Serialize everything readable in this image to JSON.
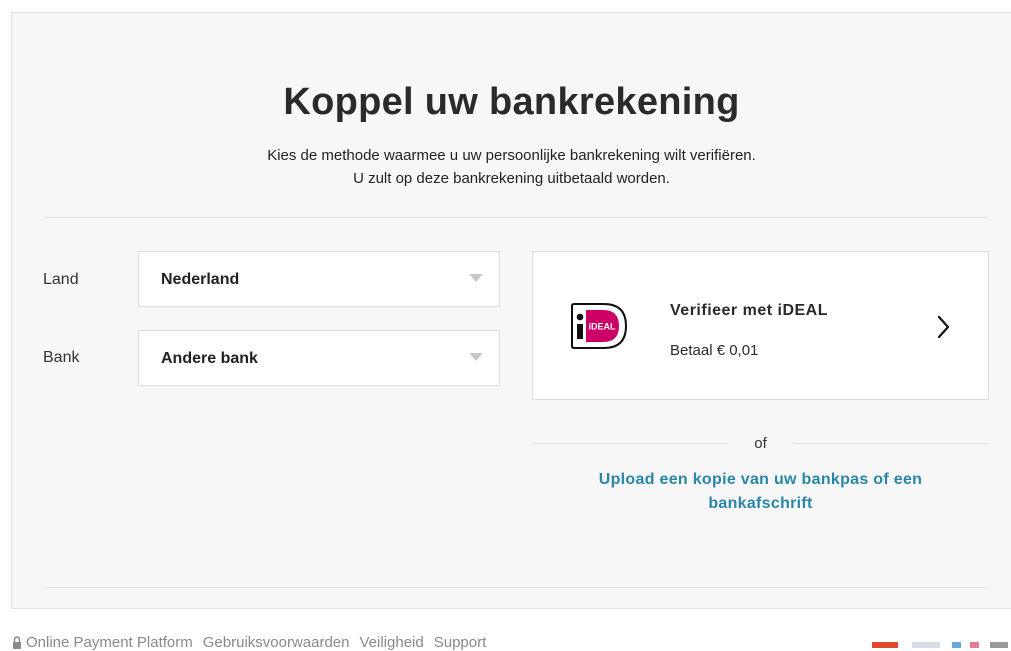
{
  "header": {
    "title": "Koppel uw bankrekening",
    "subtitle_line1": "Kies de methode waarmee u uw persoonlijke bankrekening wilt verifiëren.",
    "subtitle_line2": "U zult op deze bankrekening uitbetaald worden."
  },
  "form": {
    "country_label": "Land",
    "country_value": "Nederland",
    "bank_label": "Bank",
    "bank_value": "Andere bank"
  },
  "ideal_option": {
    "logo_text": "iDEAL",
    "title": "Verifieer met iDEAL",
    "subtitle": "Betaal € 0,01"
  },
  "alternative": {
    "separator": "of",
    "upload_line1": "Upload een kopie van uw bankpas of een",
    "upload_line2": "bankafschrift"
  },
  "footer": {
    "links": [
      "Online Payment Platform",
      "Gebruiksvoorwaarden",
      "Veiligheid",
      "Support"
    ]
  },
  "colors": {
    "accent_link": "#2a86a8",
    "ideal_pink": "#cc0066",
    "background_card": "#f7f7f7"
  },
  "icons": [
    "dropdown-caret-icon",
    "ideal-logo-icon",
    "chevron-right-icon",
    "lock-icon",
    "payment-methods-icons"
  ]
}
